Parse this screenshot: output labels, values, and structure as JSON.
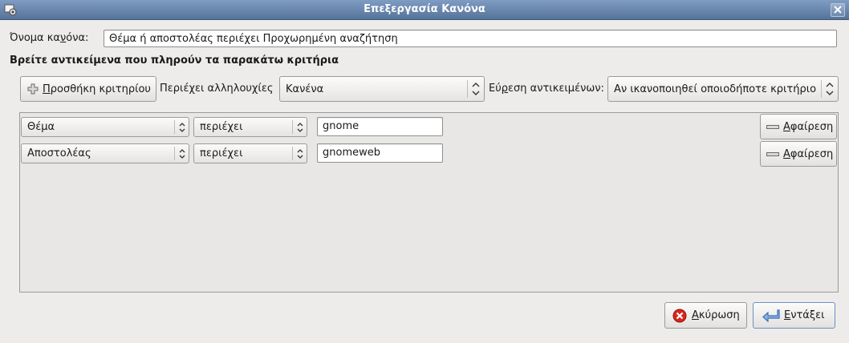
{
  "window": {
    "title": "Επεξεργασία Κανόνα"
  },
  "rule_name": {
    "label_before": "Ό",
    "label_mid": "νομα κα",
    "label_u": "ν",
    "label_after": "όνα:",
    "value": "Θέμα ή αποστολέας περιέχει Προχωρημένη αναζήτηση"
  },
  "section_heading": "Βρείτε αντικείμενα που πληρούν τα παρακάτω κριτήρια",
  "toolbar": {
    "add_criterion_u": "Π",
    "add_criterion_rest": "ροσθήκη κριτηρίου",
    "threads_label_pre": "Περιέ",
    "threads_label_u": "χ",
    "threads_label_post": "ει αλληλουχίες",
    "threads_value": "Κανένα",
    "find_label_pre": "Εύ",
    "find_label_u": "ρ",
    "find_label_post": "εση αντικειμένων:",
    "find_value": "Αν ικανοποιηθεί οποιοδήποτε κριτήριο"
  },
  "criteria": [
    {
      "field": "Θέμα",
      "operator": "περιέχει",
      "value": "gnome",
      "remove_u": "Α",
      "remove_rest": "φαίρεση"
    },
    {
      "field": "Αποστολέας",
      "operator": "περιέχει",
      "value": "gnomeweb",
      "remove_u": "Α",
      "remove_rest": "φαίρεση"
    }
  ],
  "footer": {
    "cancel_u": "Α",
    "cancel_rest": "κύρωση",
    "ok_u": "Ε",
    "ok_rest": "ντάξει"
  },
  "colors": {
    "titlebar": "#6a87ad",
    "cancel_icon": "#d8261c",
    "ok_icon": "#3b6fb5"
  }
}
